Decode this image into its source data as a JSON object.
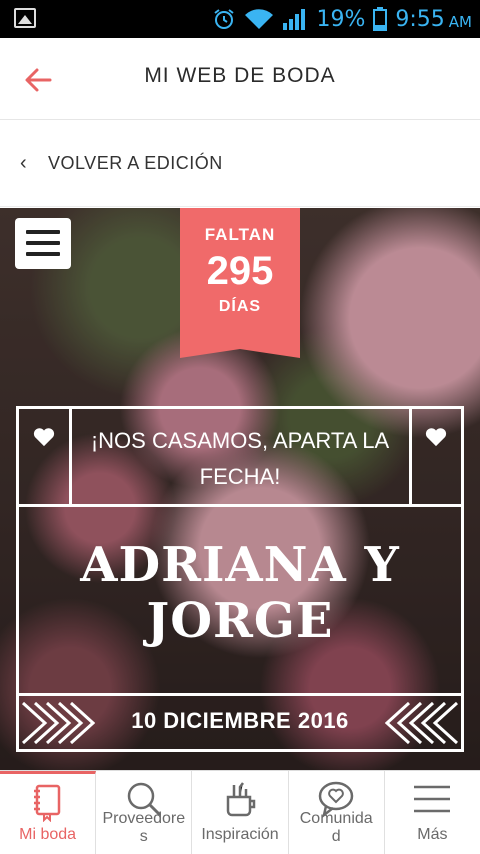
{
  "statusbar": {
    "battery_text": "19%",
    "time": "9:55",
    "ampm": "AM",
    "icons": [
      "image-icon",
      "alarm-icon",
      "wifi-icon",
      "signal-icon",
      "battery-icon"
    ]
  },
  "header": {
    "title": "MI WEB DE BODA",
    "back_icon": "arrow-left-icon"
  },
  "volver": {
    "label": "VOLVER A EDICIÓN"
  },
  "hero": {
    "countdown": {
      "top": "FALTAN",
      "number": "295",
      "bottom": "DÍAS"
    },
    "announce": "¡NOS CASAMOS, APARTA LA FECHA!",
    "names_line1": "ADRIANA Y",
    "names_line2": "JORGE",
    "date": "10 DICIEMBRE 2016"
  },
  "bottomnav": {
    "tabs": [
      {
        "label": "Mi boda",
        "icon": "notebook-icon",
        "active": true
      },
      {
        "label": "Proveedore",
        "label2": "s",
        "icon": "search-icon"
      },
      {
        "label": "Inspiración",
        "icon": "tools-icon"
      },
      {
        "label": "Comunida",
        "label2": "d",
        "icon": "chat-heart-icon"
      },
      {
        "label": "Más",
        "icon": "menu-icon"
      }
    ]
  },
  "colors": {
    "accent": "#e86464",
    "countdown_bg": "#f06a6a",
    "status_icons": "#3ab4f2"
  }
}
